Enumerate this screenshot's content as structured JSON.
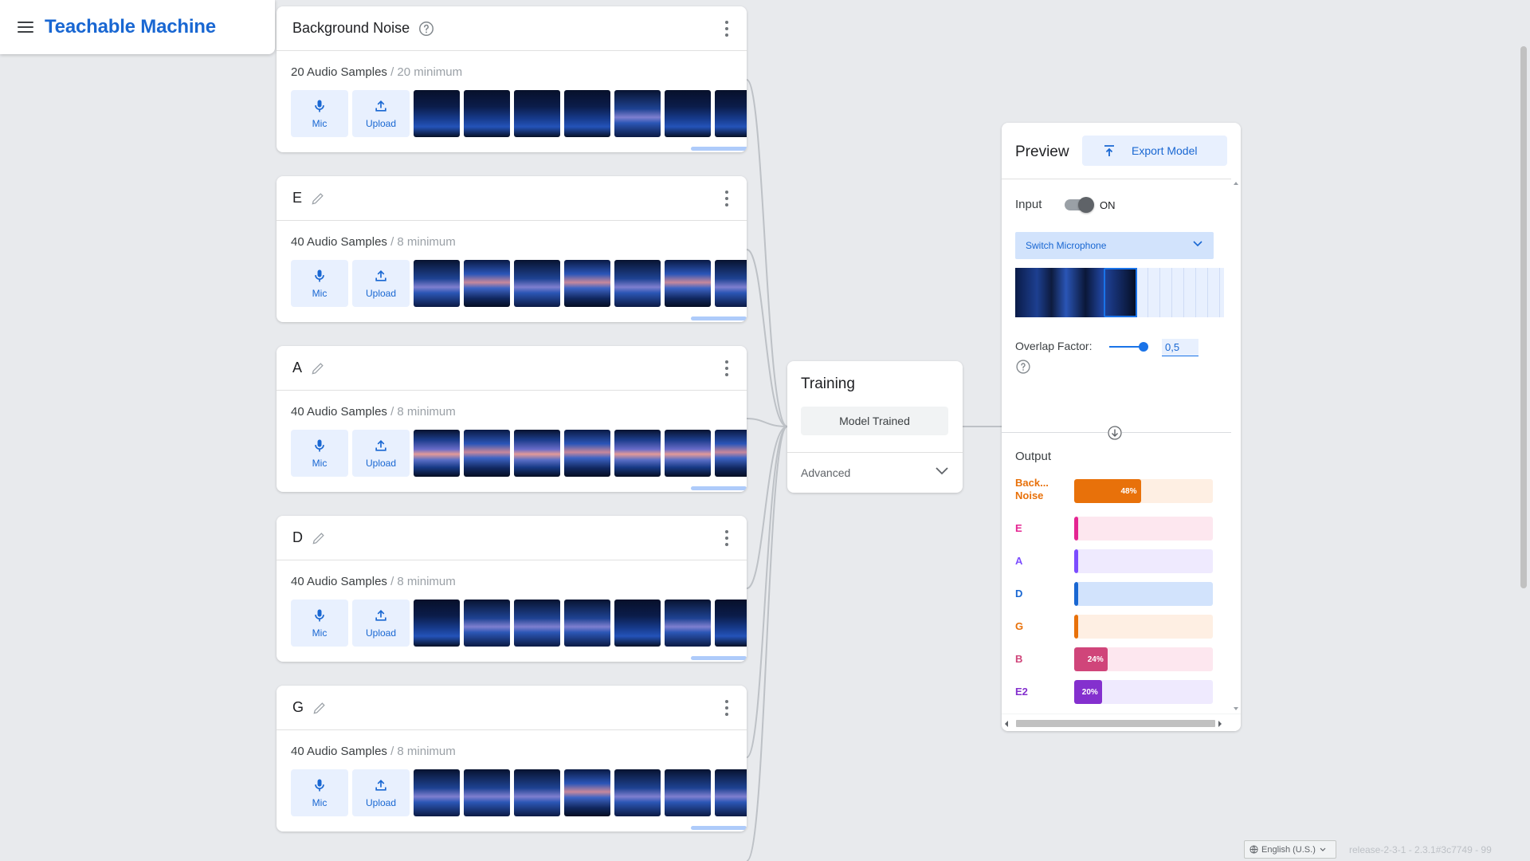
{
  "header": {
    "title": "Teachable Machine",
    "menu_icon": "menu-icon"
  },
  "classes": [
    {
      "name": "Background Noise",
      "samples": "20 Audio Samples",
      "minimum": " / 20 minimum",
      "icon": "help-icon"
    },
    {
      "name": "E",
      "samples": "40 Audio Samples",
      "minimum": " / 8 minimum",
      "icon": "edit-icon"
    },
    {
      "name": "A",
      "samples": "40 Audio Samples",
      "minimum": " / 8 minimum",
      "icon": "edit-icon"
    },
    {
      "name": "D",
      "samples": "40 Audio Samples",
      "minimum": " / 8 minimum",
      "icon": "edit-icon"
    },
    {
      "name": "G",
      "samples": "40 Audio Samples",
      "minimum": " / 8 minimum",
      "icon": "edit-icon"
    }
  ],
  "source_buttons": {
    "mic": "Mic",
    "upload": "Upload"
  },
  "training": {
    "title": "Training",
    "button": "Model Trained",
    "advanced": "Advanced"
  },
  "preview": {
    "title": "Preview",
    "export": "Export Model",
    "input_label": "Input",
    "toggle_state": "ON",
    "mic_select": "Switch Microphone",
    "overlap_label": "Overlap Factor:",
    "overlap_value": "0,5",
    "output_label": "Output",
    "outputs": [
      {
        "name": "Back... Noise",
        "percent": 48,
        "label": "48%",
        "color": "#e8710a",
        "track": "#feefe3"
      },
      {
        "name": "E",
        "percent": 1,
        "label": "",
        "color": "#e52592",
        "track": "#fde7ef"
      },
      {
        "name": "A",
        "percent": 3,
        "label": "",
        "color": "#7c4dff",
        "track": "#efeafe"
      },
      {
        "name": "D",
        "percent": 2,
        "label": "",
        "color": "#1967d2",
        "track": "#d2e3fc"
      },
      {
        "name": "G",
        "percent": 0,
        "label": "",
        "color": "#e8710a",
        "track": "#feefe3"
      },
      {
        "name": "B",
        "percent": 24,
        "label": "24%",
        "color": "#d0457a",
        "track": "#fde7ef"
      },
      {
        "name": "E2",
        "percent": 20,
        "label": "20%",
        "color": "#8430ce",
        "track": "#efeafe"
      }
    ]
  },
  "footer": {
    "language": "English (U.S.)",
    "release": "release-2-3-1 - 2.3.1#3c7749 - 99"
  },
  "colors": {
    "accent": "#1967d2",
    "background": "#e8eaed"
  }
}
